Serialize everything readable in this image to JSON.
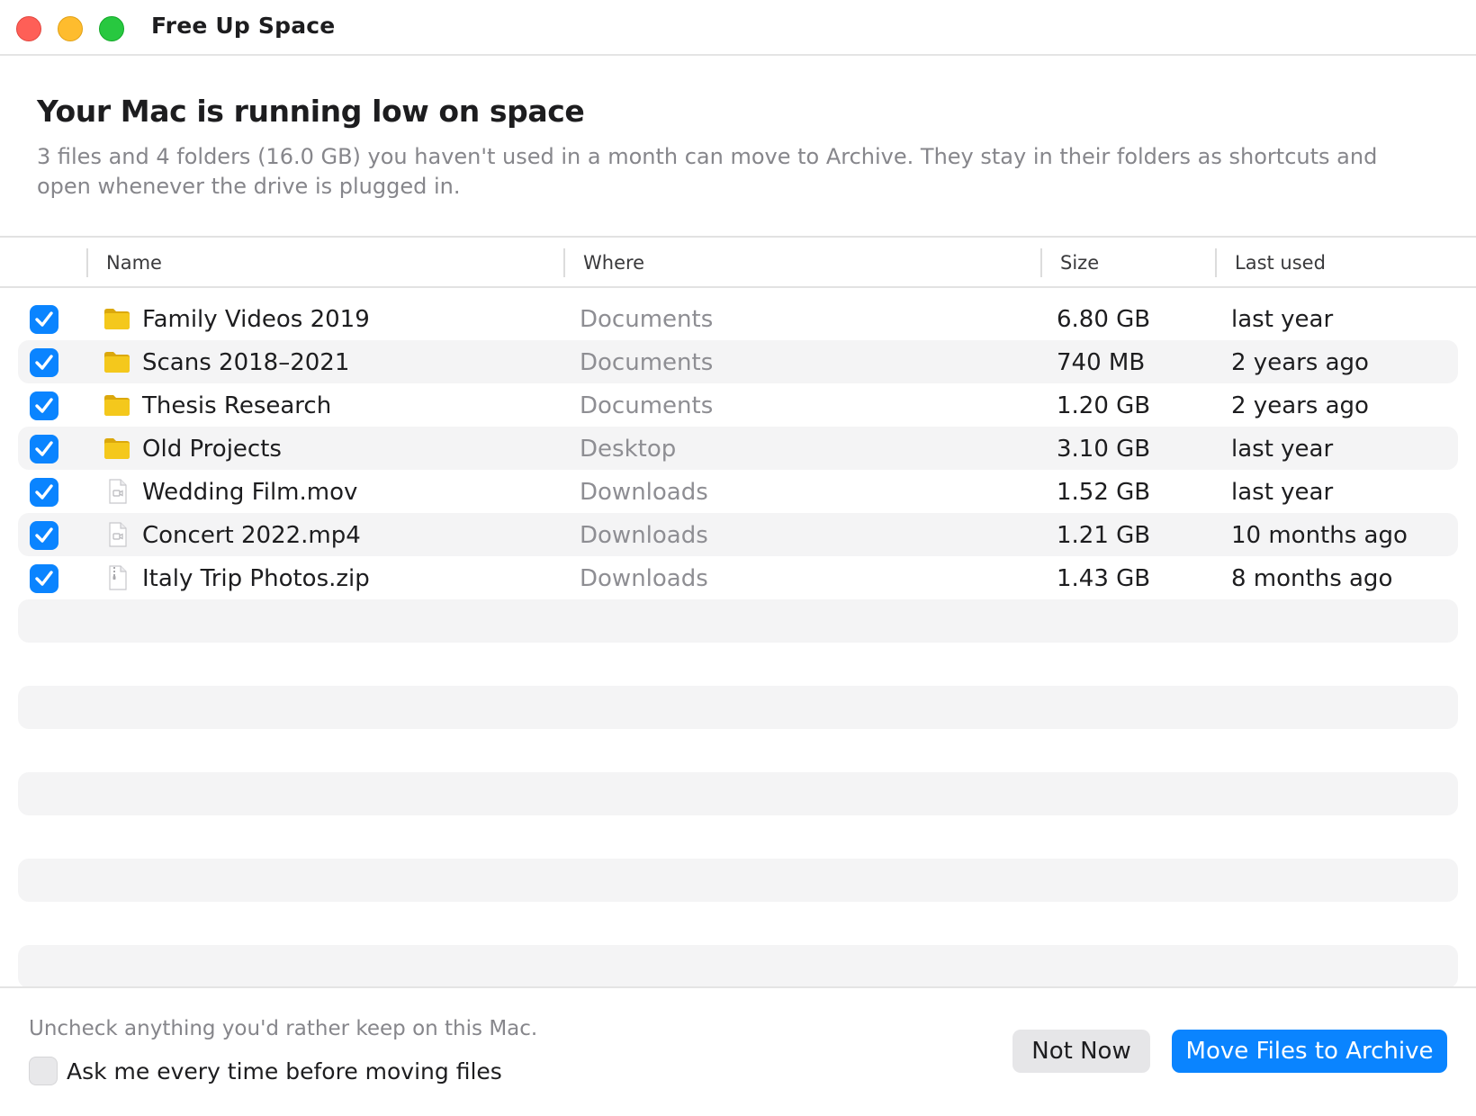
{
  "window": {
    "title": "Free Up Space",
    "controls": [
      "close",
      "minimize",
      "zoom"
    ]
  },
  "header": {
    "headline": "Your Mac is running low on space",
    "description": "3 files and 4 folders (16.0 GB) you haven't used in a month can move to Archive. They stay in their folders as shortcuts and open whenever the drive is plugged in."
  },
  "table": {
    "columns": {
      "name": "Name",
      "where": "Where",
      "size": "Size",
      "last_used": "Last used"
    },
    "rows": [
      {
        "checked": true,
        "icon": "folder-icon",
        "name": "Family Videos 2019",
        "where": "Documents",
        "size": "6.80 GB",
        "last_used": "last year"
      },
      {
        "checked": true,
        "icon": "folder-icon",
        "name": "Scans 2018–2021",
        "where": "Documents",
        "size": "740 MB",
        "last_used": "2 years ago"
      },
      {
        "checked": true,
        "icon": "folder-icon",
        "name": "Thesis Research",
        "where": "Documents",
        "size": "1.20 GB",
        "last_used": "2 years ago"
      },
      {
        "checked": true,
        "icon": "folder-icon",
        "name": "Old Projects",
        "where": "Desktop",
        "size": "3.10 GB",
        "last_used": "last year"
      },
      {
        "checked": true,
        "icon": "video-file-icon",
        "name": "Wedding Film.mov",
        "where": "Downloads",
        "size": "1.52 GB",
        "last_used": "last year"
      },
      {
        "checked": true,
        "icon": "video-file-icon",
        "name": "Concert 2022.mp4",
        "where": "Downloads",
        "size": "1.21 GB",
        "last_used": "10 months ago"
      },
      {
        "checked": true,
        "icon": "zip-file-icon",
        "name": "Italy Trip Photos.zip",
        "where": "Downloads",
        "size": "1.43 GB",
        "last_used": "8 months ago"
      }
    ]
  },
  "footer": {
    "hint": "Uncheck anything you'd rather keep on this Mac.",
    "ask_checkbox": {
      "checked": false,
      "label": "Ask me every time before moving files"
    },
    "secondary_button": "Not Now",
    "primary_button": "Move Files to Archive"
  },
  "colors": {
    "accent": "#0a84ff",
    "folder": "#f2c31a",
    "row_stripe": "#f4f4f5",
    "secondary_text": "#86868b"
  }
}
